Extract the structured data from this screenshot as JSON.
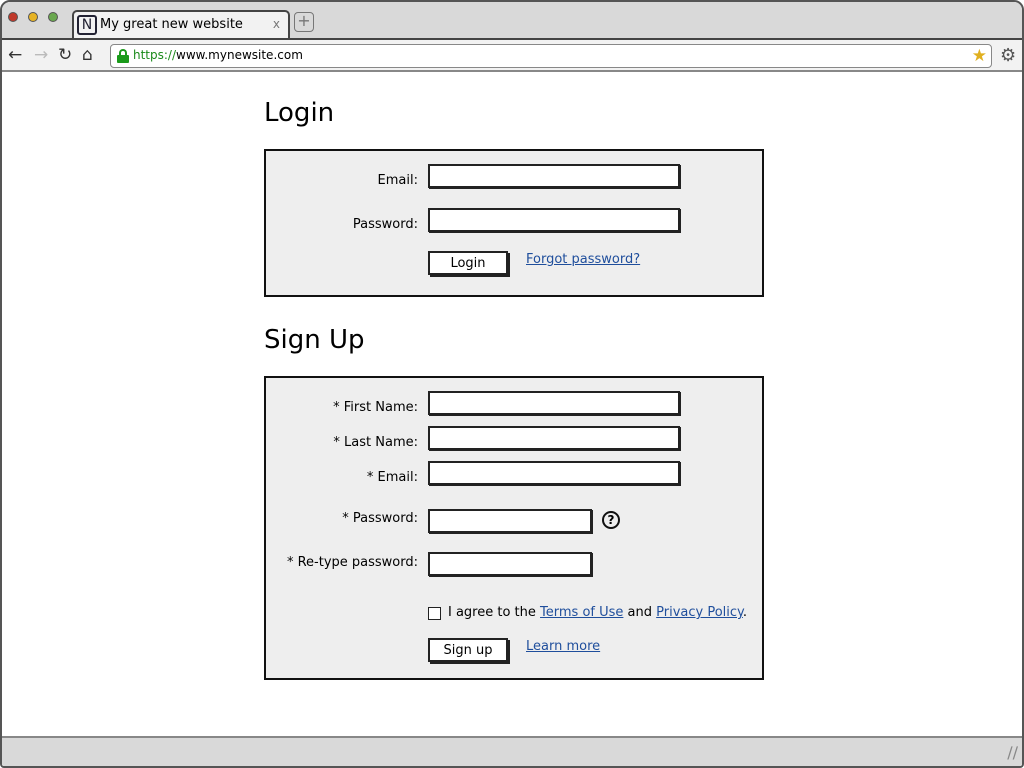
{
  "browser": {
    "tab_title": "My great new website",
    "tab_favicon": "N",
    "tab_close": "x",
    "url_scheme": "https://",
    "url_host": "www.mynewsite.com"
  },
  "icons": {
    "back": "back-arrow-icon",
    "forward": "forward-arrow-icon",
    "reload": "reload-icon",
    "home": "home-icon",
    "lock": "lock-icon",
    "bookmark": "bookmark-star-icon",
    "settings": "gear-icon",
    "help": "question-mark-icon"
  },
  "login": {
    "heading": "Login",
    "email_label": "Email:",
    "password_label": "Password:",
    "submit_label": "Login",
    "forgot_link": "Forgot password?"
  },
  "signup": {
    "heading": "Sign Up",
    "first_name_label": "* First Name:",
    "last_name_label": "* Last Name:",
    "email_label": "* Email:",
    "password_label": "* Password:",
    "retype_label": "* Re-type password:",
    "help_glyph": "?",
    "agree_prefix": "I agree to the",
    "terms_link": "Terms of Use",
    "agree_and": "and",
    "privacy_link": "Privacy Policy",
    "agree_suffix": ".",
    "submit_label": "Sign up",
    "learn_more_link": "Learn more",
    "agree_checked": false
  },
  "colors": {
    "link": "#1f4e9c",
    "panel_bg": "#eeeeee",
    "secure_green": "#1a9a1a"
  }
}
